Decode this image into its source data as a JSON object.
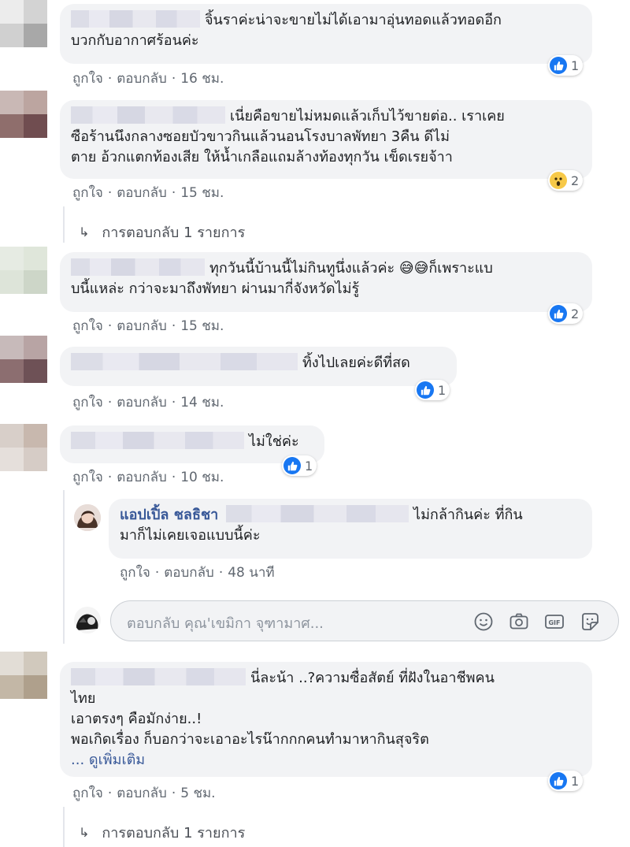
{
  "actions": {
    "like": "ถูกใจ",
    "reply": "ตอบกลับ",
    "dot": "·"
  },
  "comments": [
    {
      "text": "จิ้นราค่ะน่าจะขายไม่ได้เอามาอุ่นทอดแล้วทอดอีกบวกกับอากาศร้อนค่ะ",
      "line1": "จิ้นราค่ะน่าจะขายไม่ได้เอามาอุ่นทอดแล้วทอดอีก",
      "line2": "บวกกับอากาศร้อนค่ะ",
      "time": "16 ชม.",
      "reaction_count": "1"
    },
    {
      "line1": "เนี่ยคือขายไม่หมดแล้วเก็บไว้ขายต่อ.. เราเคย",
      "line2": "ซือร้านนึงกลางซอยบัวขาวกินแล้วนอนโรงบาลพัทยา 3คืน ดีไม่",
      "line3": "ตาย อ้วกแตกท้องเสีย ให้น้ำเกลือแถมล้างท้องทุกวัน เข็ดเรยจ้าา",
      "time": "15 ชม.",
      "reaction_count": "2"
    },
    {
      "line1": "ทุกวันนี้บ้านนี้ไม่กินทูนึ่งแล้วค่ะ 😅😅ก็เพราะแบ",
      "line2": "บนี้แหล่ะ กว่าจะมาถึงพัทยา ผ่านมากี่จังหวัดไม่รู้",
      "time": "15 ชม.",
      "reaction_count": "2"
    },
    {
      "line1": "ทิ้งไปเลยค่ะดีที่สด",
      "time": "14 ชม.",
      "reaction_count": "1"
    },
    {
      "line1": "ไม่ใช่ค่ะ",
      "time": "10 ชม.",
      "reaction_count": "1"
    },
    {
      "line1": "นี่ละน้า ..?ความซื่อสัตย์ ที่ฝังในอาชีพคน",
      "line2": "ไทย",
      "line3": "เอาตรงๆ คือมักง่าย..!",
      "line4": "พอเกิดเรื่อง ก็บอกว่าจะเอาอะไรน๊ากกกคนทำมาหากินสุจริต",
      "see_more": "... ดูเพิ่มเติม",
      "time": "5 ชม.",
      "reaction_count": "1"
    }
  ],
  "reply": {
    "name": "แอปเปิ้ล ชลธิชา",
    "line1": "ไม่กล้ากินค่ะ ที่กิน",
    "line2": "มาก็ไม่เคยเจอแบบนี้ค่ะ",
    "time": "48 นาที"
  },
  "replies_link": "การตอบกลับ 1 รายการ",
  "composer": {
    "placeholder": "ตอบกลับ คุณ'เขมิกา จุฑามาศ..."
  },
  "icons": [
    "emoji-icon",
    "camera-icon",
    "gif-icon",
    "sticker-icon"
  ],
  "colors": {
    "like_blue": "#1877f2",
    "bubble": "#f2f3f5",
    "link": "#385898",
    "meta": "#606770"
  }
}
